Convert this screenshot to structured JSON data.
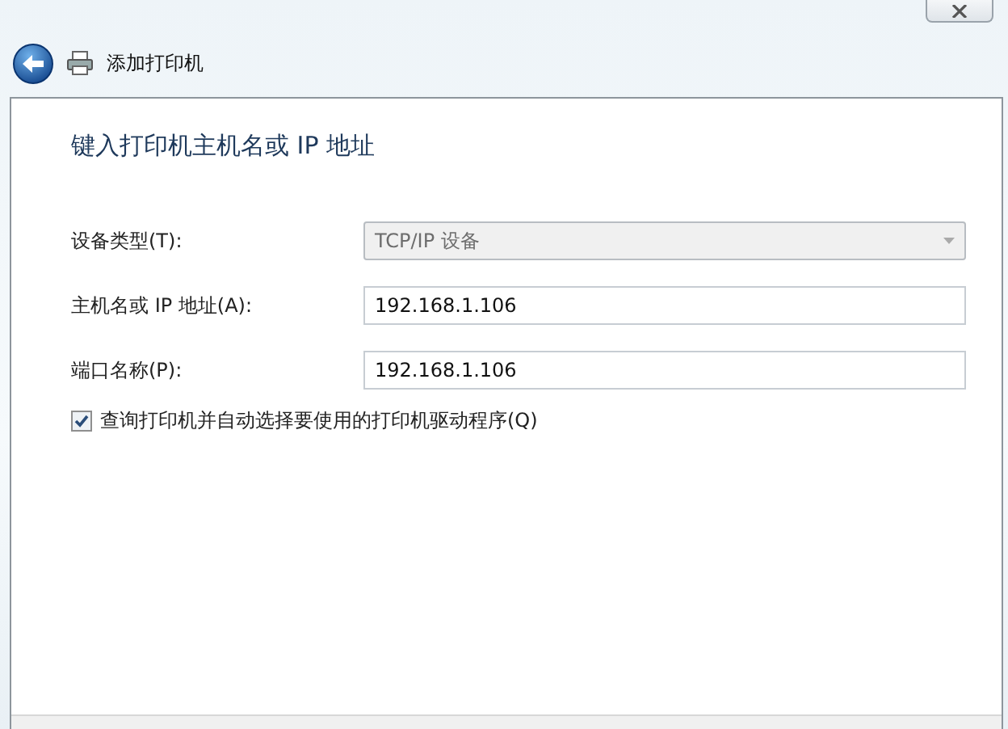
{
  "window": {
    "title": "添加打印机"
  },
  "heading": "键入打印机主机名或 IP 地址",
  "fields": [
    {
      "kind": "combo",
      "label": "设备类型(T):",
      "value": "TCP/IP 设备",
      "disabled": true
    },
    {
      "kind": "text",
      "label": "主机名或 IP 地址(A):",
      "value": "192.168.1.106",
      "disabled": false
    },
    {
      "kind": "text",
      "label": "端口名称(P):",
      "value": "192.168.1.106",
      "disabled": false
    }
  ],
  "checkbox": {
    "label": "查询打印机并自动选择要使用的打印机驱动程序(Q)",
    "checked": true
  }
}
